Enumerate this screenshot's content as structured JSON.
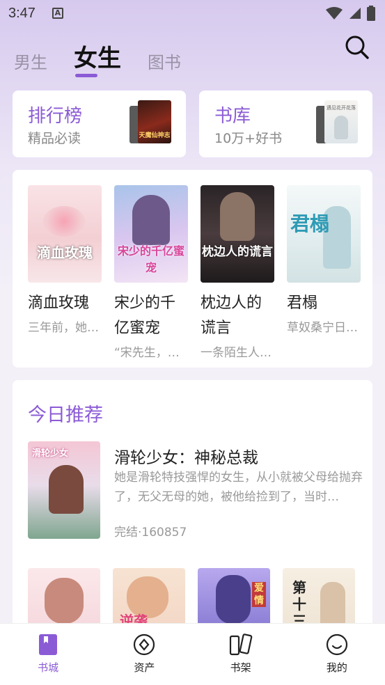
{
  "status_bar": {
    "time": "3:47",
    "notice_letter": "A"
  },
  "top_tabs": [
    {
      "label": "男生",
      "active": false
    },
    {
      "label": "女生",
      "active": true
    },
    {
      "label": "图书",
      "active": false
    }
  ],
  "featured": [
    {
      "title": "排行榜",
      "subtitle": "精品必读",
      "cover_text": "天魔仙神志"
    },
    {
      "title": "书库",
      "subtitle": "10万+好书",
      "cover_text": "遇见花开花落"
    }
  ],
  "popular_books": [
    {
      "title": "滴血玫瑰",
      "description": "三年前，她…",
      "cover_text": "滴血玫瑰",
      "cover_color": "#f3cfd3"
    },
    {
      "title": "宋少的千亿蜜宠",
      "description": "“宋先生，…",
      "cover_text": "宋少的千亿蜜宠",
      "cover_color": "#cbb9e4"
    },
    {
      "title": "枕边人的谎言",
      "description": "一条陌生人…",
      "cover_text": "枕边人的谎言",
      "cover_color": "#3b3538"
    },
    {
      "title": "君榻",
      "description": "草奴桑宁日…",
      "cover_text": "君榻",
      "cover_color": "#e6f0f2"
    }
  ],
  "recommendation": {
    "section_title": "今日推荐",
    "book_title": "滑轮少女：神秘总裁",
    "description": "她是滑轮特技强悍的女生，从小就被父母给抛弃了，无父无母的她，被他给捡到了，当时…",
    "meta": "完结·160857",
    "cover_text": "滑轮少女"
  },
  "more_covers": [
    {
      "cover_color": "#f7dcdf",
      "cover_text": ""
    },
    {
      "cover_color": "#f3d9c4",
      "cover_text": "逆袭"
    },
    {
      "cover_color": "#8a7fd1",
      "cover_text": "爱情"
    },
    {
      "cover_color": "#efe4d6",
      "cover_text": "第十三"
    }
  ],
  "bottom_nav": [
    {
      "label": "书城",
      "icon": "bookstore-icon",
      "active": true
    },
    {
      "label": "资产",
      "icon": "assets-icon",
      "active": false
    },
    {
      "label": "书架",
      "icon": "bookshelf-icon",
      "active": false
    },
    {
      "label": "我的",
      "icon": "profile-icon",
      "active": false
    }
  ],
  "colors": {
    "accent": "#8b5bd6",
    "muted": "#999999",
    "text": "#222222"
  }
}
